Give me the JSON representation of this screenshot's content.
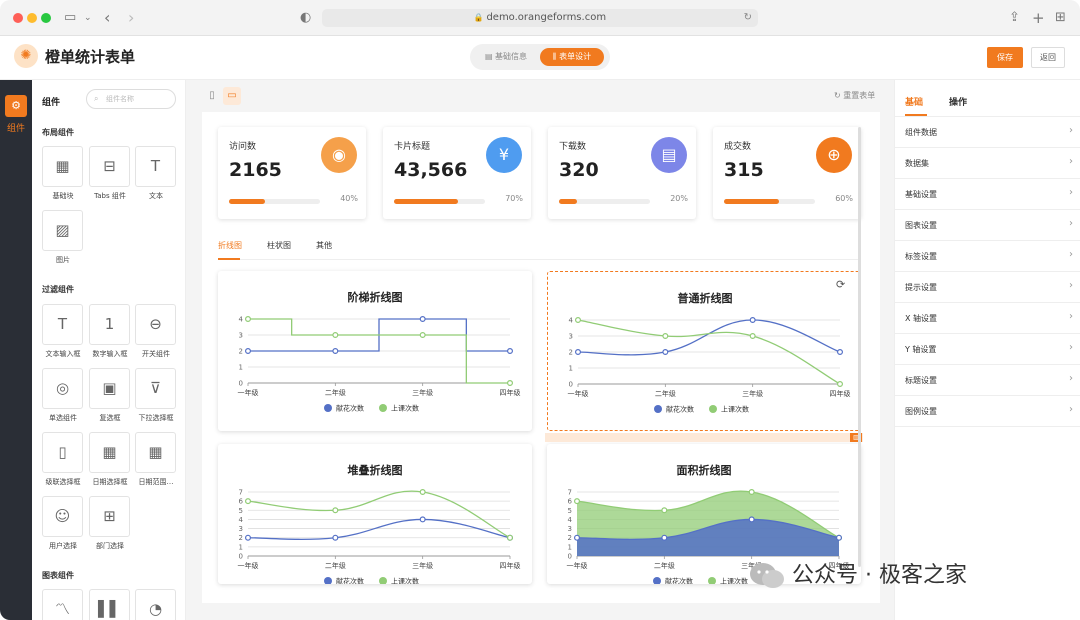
{
  "browser": {
    "url": "demo.orangeforms.com"
  },
  "app": {
    "title": "橙单统计表单",
    "seg_basic": "基础信息",
    "seg_design": "表单设计",
    "save": "保存",
    "back": "返回"
  },
  "rail": {
    "label": "组件"
  },
  "panel": {
    "title": "组件",
    "search_placeholder": "组件名称",
    "sections": [
      {
        "title": "布局组件",
        "items": [
          "基础块",
          "Tabs 组件",
          "文本",
          "图片"
        ]
      },
      {
        "title": "过滤组件",
        "items": [
          "文本输入框",
          "数字输入框",
          "开关组件",
          "单选组件",
          "复选框",
          "下拉选择框",
          "级联选择框",
          "日期选择框",
          "日期范围…",
          "用户选择",
          "部门选择"
        ]
      },
      {
        "title": "图表组件",
        "items": [
          "",
          "",
          ""
        ]
      }
    ]
  },
  "canvas": {
    "reset": "重置表单"
  },
  "stats": [
    {
      "title": "访问数",
      "value": "2165",
      "percent": "40%",
      "progress": 0.4,
      "color": "#f5a04a",
      "icon": "lightbulb-icon"
    },
    {
      "title": "卡片标题",
      "value": "43,566",
      "percent": "70%",
      "progress": 0.7,
      "color": "#4f9cf0",
      "icon": "yen-download-icon"
    },
    {
      "title": "下载数",
      "value": "320",
      "percent": "20%",
      "progress": 0.2,
      "color": "#7d86e8",
      "icon": "document-upload-icon"
    },
    {
      "title": "成交数",
      "value": "315",
      "percent": "60%",
      "progress": 0.6,
      "color": "#f17a1f",
      "icon": "deal-icon"
    }
  ],
  "tabs": [
    "折线图",
    "柱状图",
    "其他"
  ],
  "legend": {
    "a": "献花次数",
    "b": "上课次数"
  },
  "chart_data": [
    {
      "type": "line",
      "title": "阶梯折线图",
      "style": "step",
      "categories": [
        "一年级",
        "二年级",
        "三年级",
        "四年级"
      ],
      "ylim": [
        0,
        4
      ],
      "yticks": [
        0,
        1,
        2,
        3,
        4
      ],
      "series": [
        {
          "name": "献花次数",
          "color": "#5470c6",
          "values": [
            2,
            2,
            4,
            2
          ]
        },
        {
          "name": "上课次数",
          "color": "#91cc75",
          "values": [
            4,
            3,
            3,
            0
          ]
        }
      ]
    },
    {
      "type": "line",
      "title": "普通折线图",
      "style": "smooth",
      "categories": [
        "一年级",
        "二年级",
        "三年级",
        "四年级"
      ],
      "ylim": [
        0,
        4
      ],
      "yticks": [
        0,
        1,
        2,
        3,
        4
      ],
      "series": [
        {
          "name": "献花次数",
          "color": "#5470c6",
          "values": [
            2,
            2,
            4,
            2
          ]
        },
        {
          "name": "上课次数",
          "color": "#91cc75",
          "values": [
            4,
            3,
            3,
            0
          ]
        }
      ]
    },
    {
      "type": "line",
      "title": "堆叠折线图",
      "style": "smooth",
      "categories": [
        "一年级",
        "二年级",
        "三年级",
        "四年级"
      ],
      "ylim": [
        0,
        7
      ],
      "yticks": [
        0,
        1,
        2,
        3,
        4,
        5,
        6,
        7
      ],
      "series": [
        {
          "name": "献花次数",
          "color": "#5470c6",
          "values": [
            2,
            2,
            4,
            2
          ]
        },
        {
          "name": "上课次数",
          "color": "#91cc75",
          "values": [
            6,
            5,
            7,
            2
          ]
        }
      ]
    },
    {
      "type": "area",
      "title": "面积折线图",
      "style": "smooth",
      "categories": [
        "一年级",
        "二年级",
        "三年级",
        "四年级"
      ],
      "ylim": [
        0,
        7
      ],
      "yticks": [
        0,
        1,
        2,
        3,
        4,
        5,
        6,
        7
      ],
      "series": [
        {
          "name": "献花次数",
          "color": "#5470c6",
          "values": [
            2,
            2,
            4,
            2
          ]
        },
        {
          "name": "上课次数",
          "color": "#91cc75",
          "values": [
            6,
            5,
            7,
            2
          ]
        }
      ]
    }
  ],
  "props": {
    "tab_basic": "基础",
    "tab_action": "操作",
    "items": [
      "组件数据",
      "数据集",
      "基础设置",
      "图表设置",
      "标签设置",
      "提示设置",
      "X 轴设置",
      "Y 轴设置",
      "标题设置",
      "图例设置"
    ]
  },
  "watermark": "公众号 · 极客之家"
}
